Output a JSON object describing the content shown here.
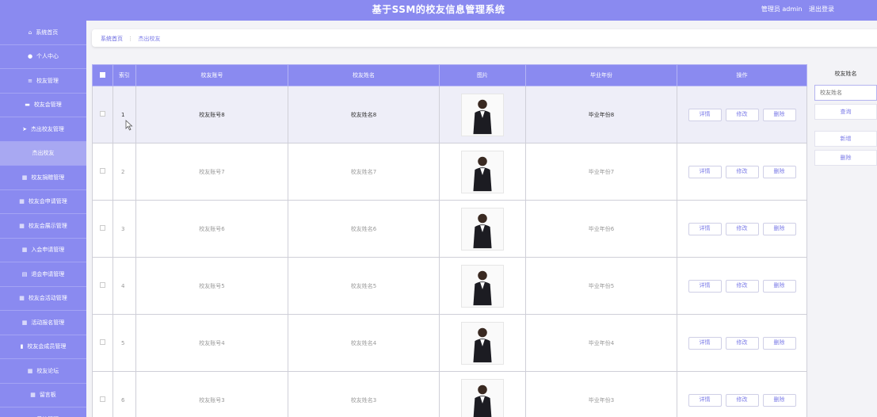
{
  "header": {
    "title": "基于SSM的校友信息管理系统",
    "role": "管理员 admin",
    "logout": "退出登录"
  },
  "sidebar": {
    "items": [
      {
        "icon": "home-icon",
        "glyph": "⌂",
        "label": "系统首页"
      },
      {
        "icon": "person-icon",
        "glyph": "●",
        "label": "个人中心"
      },
      {
        "icon": "list-icon",
        "glyph": "≡",
        "label": "校友管理"
      },
      {
        "icon": "chat-icon",
        "glyph": "▬",
        "label": "校友会管理"
      },
      {
        "icon": "send-icon",
        "glyph": "➤",
        "label": "杰出校友管理"
      },
      {
        "icon": "",
        "glyph": "",
        "label": "杰出校友",
        "sub": true
      },
      {
        "icon": "grid-icon",
        "glyph": "▦",
        "label": "校友捐赠管理"
      },
      {
        "icon": "grid-icon",
        "glyph": "▦",
        "label": "校友会申请管理"
      },
      {
        "icon": "grid-icon",
        "glyph": "▦",
        "label": "校友会展示管理"
      },
      {
        "icon": "grid-icon",
        "glyph": "▦",
        "label": "入会申请管理"
      },
      {
        "icon": "table-icon",
        "glyph": "▤",
        "label": "退会申请管理"
      },
      {
        "icon": "grid-icon",
        "glyph": "▦",
        "label": "校友会活动管理"
      },
      {
        "icon": "grid-icon",
        "glyph": "▦",
        "label": "活动报名管理"
      },
      {
        "icon": "clipboard-icon",
        "glyph": "▮",
        "label": "校友会成员管理"
      },
      {
        "icon": "grid-icon",
        "glyph": "▦",
        "label": "校友论坛"
      },
      {
        "icon": "grid-icon",
        "glyph": "▦",
        "label": "留言板"
      },
      {
        "icon": "grid-icon",
        "glyph": "▦",
        "label": "系统管理"
      }
    ]
  },
  "breadcrumb": {
    "home": "系统首页",
    "separator": "⋮",
    "current": "杰出校友"
  },
  "table": {
    "headers": {
      "index": "索引",
      "account": "校友账号",
      "name": "校友姓名",
      "photo": "图片",
      "year": "毕业年份",
      "ops": "操作"
    },
    "ops": {
      "detail": "详情",
      "edit": "修改",
      "delete": "删除"
    },
    "rows": [
      {
        "index": "1",
        "account": "校友账号8",
        "name": "校友姓名8",
        "year": "毕业年份8",
        "highlight": true
      },
      {
        "index": "2",
        "account": "校友账号7",
        "name": "校友姓名7",
        "year": "毕业年份7"
      },
      {
        "index": "3",
        "account": "校友账号6",
        "name": "校友姓名6",
        "year": "毕业年份6"
      },
      {
        "index": "4",
        "account": "校友账号5",
        "name": "校友姓名5",
        "year": "毕业年份5"
      },
      {
        "index": "5",
        "account": "校友账号4",
        "name": "校友姓名4",
        "year": "毕业年份4"
      },
      {
        "index": "6",
        "account": "校友账号3",
        "name": "校友姓名3",
        "year": "毕业年份3"
      }
    ]
  },
  "search": {
    "label": "校友姓名",
    "placeholder": "校友姓名",
    "query": "查询",
    "add": "新增",
    "delete": "删除"
  },
  "colors": {
    "accent": "#8a8af0",
    "link": "#7c7ce8"
  }
}
